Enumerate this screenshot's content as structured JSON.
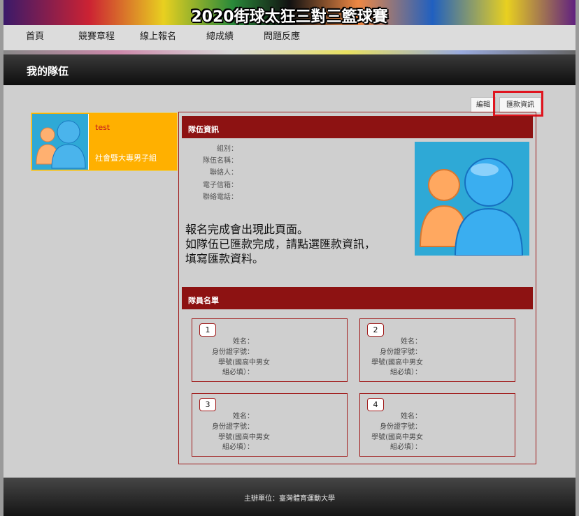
{
  "banner": {
    "title": "2020街球太狂三對三籃球賽"
  },
  "nav": {
    "items": [
      {
        "label": "首頁"
      },
      {
        "label": "競賽章程"
      },
      {
        "label": "線上報名"
      },
      {
        "label": "總成績"
      },
      {
        "label": "問題反應"
      }
    ]
  },
  "page": {
    "title": "我的隊伍"
  },
  "actions": {
    "edit_label": "編輯",
    "payment_label": "匯款資訊"
  },
  "team_card": {
    "name": "test",
    "group": "社會暨大專男子組",
    "avatar_icon": "users-icon"
  },
  "team_info": {
    "section_title": "隊伍資訊",
    "fields": [
      {
        "label": "組別："
      },
      {
        "label": "隊伍名稱："
      },
      {
        "label": "聯絡人："
      },
      {
        "label": "電子信箱："
      },
      {
        "label": "聯絡電話："
      }
    ],
    "notice": [
      "報名完成會出現此頁面。",
      "如隊伍已匯款完成，請點選匯款資訊，",
      "填寫匯款資料。"
    ],
    "avatar_icon": "users-icon"
  },
  "members": {
    "section_title": "隊員名單",
    "items": [
      {
        "num": "1",
        "name_label": "姓名：",
        "id_label": "身份證字號：",
        "school_label_1": "學號(國高中男女",
        "school_label_2": "組必填）："
      },
      {
        "num": "2",
        "name_label": "姓名：",
        "id_label": "身份證字號：",
        "school_label_1": "學號(國高中男女",
        "school_label_2": "組必填）："
      },
      {
        "num": "3",
        "name_label": "姓名：",
        "id_label": "身份證字號：",
        "school_label_1": "學號(國高中男女",
        "school_label_2": "組必填）："
      },
      {
        "num": "4",
        "name_label": "姓名：",
        "id_label": "身份證字號：",
        "school_label_1": "學號(國高中男女",
        "school_label_2": "組必填）："
      }
    ]
  },
  "footer": {
    "text": "主辦單位：臺灣體育運動大學"
  },
  "colors": {
    "accent": "#8d1212",
    "card": "#ffb000",
    "highlight": "#e0141e",
    "avatar_bg": "#2ea9d6"
  }
}
